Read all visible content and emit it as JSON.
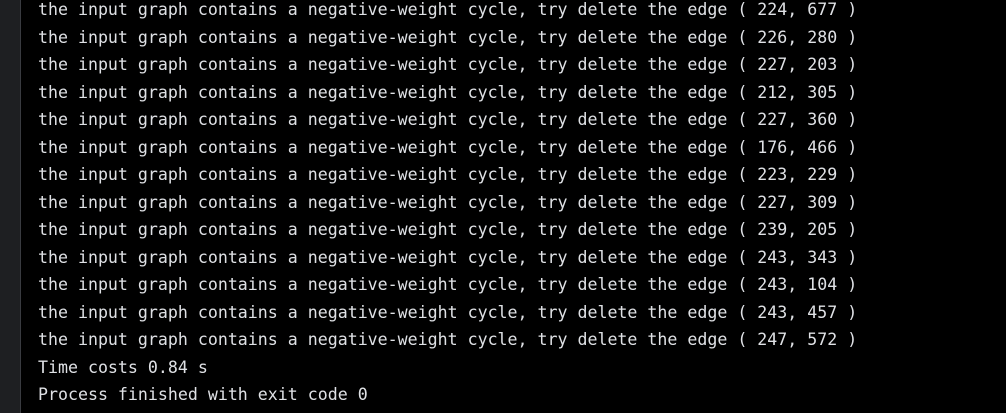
{
  "console": {
    "lines": [
      "the input graph contains a negative-weight cycle, try delete the edge ( 224, 677 )",
      "the input graph contains a negative-weight cycle, try delete the edge ( 226, 280 )",
      "the input graph contains a negative-weight cycle, try delete the edge ( 227, 203 )",
      "the input graph contains a negative-weight cycle, try delete the edge ( 212, 305 )",
      "the input graph contains a negative-weight cycle, try delete the edge ( 227, 360 )",
      "the input graph contains a negative-weight cycle, try delete the edge ( 176, 466 )",
      "the input graph contains a negative-weight cycle, try delete the edge ( 223, 229 )",
      "the input graph contains a negative-weight cycle, try delete the edge ( 227, 309 )",
      "the input graph contains a negative-weight cycle, try delete the edge ( 239, 205 )",
      "the input graph contains a negative-weight cycle, try delete the edge ( 243, 343 )",
      "the input graph contains a negative-weight cycle, try delete the edge ( 243, 104 )",
      "the input graph contains a negative-weight cycle, try delete the edge ( 243, 457 )",
      "the input graph contains a negative-weight cycle, try delete the edge ( 247, 572 )",
      "Time costs 0.84 s",
      "Process finished with exit code 0"
    ]
  },
  "colors": {
    "background": "#000000",
    "text": "#dfe1e5",
    "gutter": "#1e1f22"
  }
}
